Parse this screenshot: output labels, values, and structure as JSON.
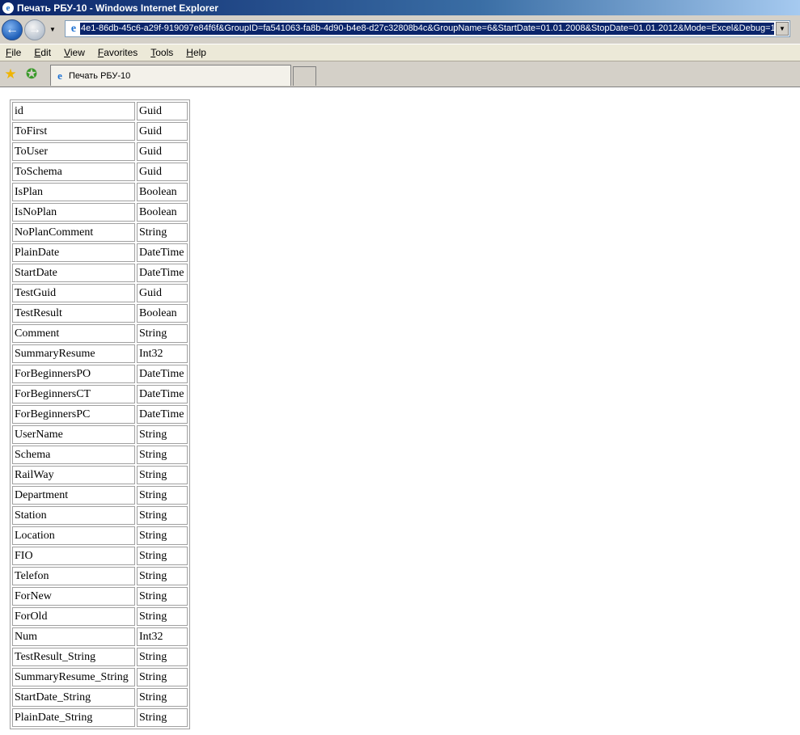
{
  "window": {
    "title": "Печать РБУ-10 - Windows Internet Explorer"
  },
  "address": {
    "url": "4e1-86db-45c6-a29f-919097e84f6f&GroupID=fa541063-fa8b-4d90-b4e8-d27c32808b4c&GroupName=6&StartDate=01.01.2008&StopDate=01.01.2012&Mode=Excel&Debug=1"
  },
  "menu": {
    "items": [
      "File",
      "Edit",
      "View",
      "Favorites",
      "Tools",
      "Help"
    ]
  },
  "tab": {
    "label": "Печать РБУ-10"
  },
  "table": {
    "rows": [
      {
        "name": "id",
        "type": "Guid"
      },
      {
        "name": "ToFirst",
        "type": "Guid"
      },
      {
        "name": "ToUser",
        "type": "Guid"
      },
      {
        "name": "ToSchema",
        "type": "Guid"
      },
      {
        "name": "IsPlan",
        "type": "Boolean"
      },
      {
        "name": "IsNoPlan",
        "type": "Boolean"
      },
      {
        "name": "NoPlanComment",
        "type": "String"
      },
      {
        "name": "PlainDate",
        "type": "DateTime"
      },
      {
        "name": "StartDate",
        "type": "DateTime"
      },
      {
        "name": "TestGuid",
        "type": "Guid"
      },
      {
        "name": "TestResult",
        "type": "Boolean"
      },
      {
        "name": "Comment",
        "type": "String"
      },
      {
        "name": "SummaryResume",
        "type": "Int32"
      },
      {
        "name": "ForBeginnersPO",
        "type": "DateTime"
      },
      {
        "name": "ForBeginnersCT",
        "type": "DateTime"
      },
      {
        "name": "ForBeginnersPC",
        "type": "DateTime"
      },
      {
        "name": "UserName",
        "type": "String"
      },
      {
        "name": "Schema",
        "type": "String"
      },
      {
        "name": "RailWay",
        "type": "String"
      },
      {
        "name": "Department",
        "type": "String"
      },
      {
        "name": "Station",
        "type": "String"
      },
      {
        "name": "Location",
        "type": "String"
      },
      {
        "name": "FIO",
        "type": "String"
      },
      {
        "name": "Telefon",
        "type": "String"
      },
      {
        "name": "ForNew",
        "type": "String"
      },
      {
        "name": "ForOld",
        "type": "String"
      },
      {
        "name": "Num",
        "type": "Int32"
      },
      {
        "name": "TestResult_String",
        "type": "String"
      },
      {
        "name": "SummaryResume_String",
        "type": "String"
      },
      {
        "name": "StartDate_String",
        "type": "String"
      },
      {
        "name": "PlainDate_String",
        "type": "String"
      }
    ]
  }
}
